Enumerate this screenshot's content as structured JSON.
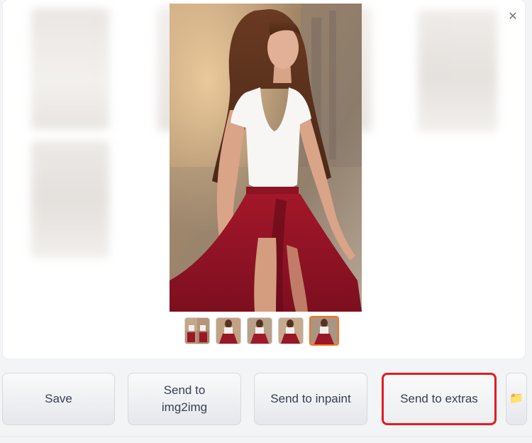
{
  "gallery": {
    "close_glyph": "✕",
    "thumbnail_count": 5,
    "selected_index": 4
  },
  "actions": {
    "save_label": "Save",
    "img2img_line1": "Send to",
    "img2img_line2": "img2img",
    "inpaint_label": "Send to inpaint",
    "extras_label": "Send to extras",
    "folder_icon": "📁"
  },
  "colors": {
    "selected_thumb_border": "#f97316",
    "highlight_box": "#e11d21"
  }
}
